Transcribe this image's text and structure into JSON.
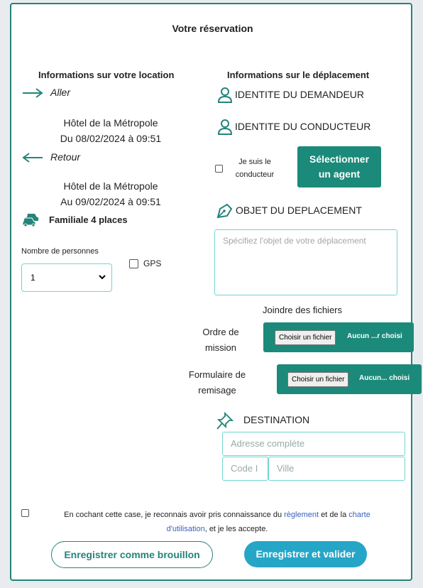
{
  "title": "Votre réservation",
  "location": {
    "heading": "Informations sur votre location",
    "aller_label": "Aller",
    "aller_place": "Hôtel de la Métropole",
    "aller_date": "Du 08/02/2024 à 09:51",
    "retour_label": "Retour",
    "retour_place": "Hôtel de la Métropole",
    "retour_date": "Au 09/02/2024 à 09:51",
    "vehicle": "Familiale 4 places",
    "persons_label": "Nombre de personnes",
    "persons_value": "1",
    "gps_label": "GPS"
  },
  "deplacement": {
    "heading": "Informations sur le déplacement",
    "demandeur": "IDENTITE DU DEMANDEUR",
    "conducteur": "IDENTITE DU CONDUCTEUR",
    "je_suis_line1": "Je suis le",
    "je_suis_line2": "conducteur",
    "select_agent_line1": "Sélectionner",
    "select_agent_line2": "un agent",
    "objet": "OBJET DU DEPLACEMENT",
    "objet_placeholder": "Spécifiez l'objet de votre déplacement",
    "joindre": "Joindre des fichiers",
    "ordre_line1": "Ordre de",
    "ordre_line2": "mission",
    "formulaire_line1": "Formulaire de",
    "formulaire_line2": "remisage",
    "choose_file": "Choisir un fichier",
    "ordre_file_status": "Aucun ...r choisi",
    "formulaire_file_status": "Aucun... choisi",
    "destination": "DESTINATION",
    "address_placeholder": "Adresse complète",
    "code_placeholder": "Code I",
    "ville_placeholder": "Ville"
  },
  "consent": {
    "text_before": "En cochant cette case, je reconnais avoir pris connaissance du",
    "reglement": "règlement",
    "text_middle": "et de la",
    "charte": "charte",
    "utilisation": "d'utilisation",
    "text_after": ", et je les accepte."
  },
  "buttons": {
    "draft": "Enregistrer comme brouillon",
    "validate": "Enregistrer et valider"
  },
  "colors": {
    "teal": "#1b8a7a",
    "border": "#23847a",
    "input_border": "#6fd6cf",
    "link": "#3b5fc0",
    "validate_button": "#25a6c7"
  }
}
